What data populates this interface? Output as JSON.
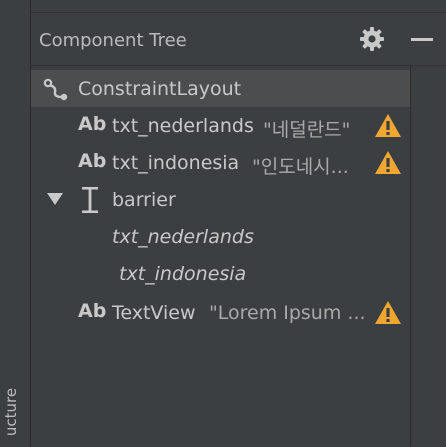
{
  "side_panel": {
    "tab_label": "ucture"
  },
  "header": {
    "title": "Component Tree",
    "settings_icon": "gear-icon",
    "minimize_icon": "minimize-icon"
  },
  "tree": {
    "root": {
      "label": "ConstraintLayout",
      "icon": "constraint-layout-icon",
      "selected": true
    },
    "items": [
      {
        "label": "txt_nederlands",
        "text": "\"네덜란드\"",
        "icon": "textview-icon",
        "warning": true
      },
      {
        "label": "txt_indonesia",
        "text": "\"인도네시...",
        "icon": "textview-icon",
        "warning": true
      },
      {
        "label": "barrier",
        "icon": "barrier-icon",
        "expanded": true,
        "children": [
          "txt_nederlands",
          "txt_indonesia"
        ]
      },
      {
        "label": "TextView",
        "text": "\"Lorem Ipsum ...",
        "icon": "textview-icon",
        "warning": true
      }
    ]
  },
  "colors": {
    "panel_bg": "#3c3f41",
    "selected_row": "#4b4d4f",
    "text": "#c9c9c9",
    "warning": "#f0a732"
  }
}
